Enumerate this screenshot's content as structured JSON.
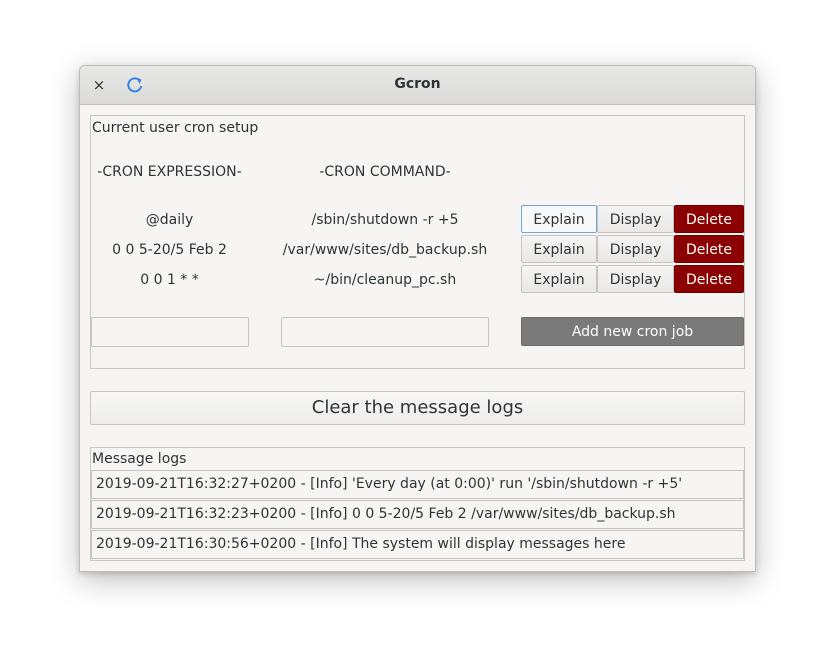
{
  "window": {
    "title": "Gcron"
  },
  "titlebar": {
    "close_glyph": "×",
    "refresh_icon": "refresh-icon"
  },
  "cron_setup": {
    "label": "Current user cron setup",
    "headers": {
      "expression": "-CRON EXPRESSION-",
      "command": "-CRON COMMAND-"
    },
    "jobs": [
      {
        "expression": "@daily",
        "command": "/sbin/shutdown -r +5",
        "explain": "Explain",
        "display": "Display",
        "delete": "Delete"
      },
      {
        "expression": "0 0 5-20/5 Feb 2",
        "command": "/var/www/sites/db_backup.sh",
        "explain": "Explain",
        "display": "Display",
        "delete": "Delete"
      },
      {
        "expression": "0 0 1 * *",
        "command": "~/bin/cleanup_pc.sh",
        "explain": "Explain",
        "display": "Display",
        "delete": "Delete"
      }
    ],
    "new_expression": {
      "value": "",
      "placeholder": ""
    },
    "new_command": {
      "value": "",
      "placeholder": ""
    },
    "add_button": "Add new cron job"
  },
  "clear_button": "Clear the message logs",
  "message_logs": {
    "label": "Message logs",
    "entries": [
      "2019-09-21T16:32:27+0200 - [Info] 'Every day (at 0:00)' run '/sbin/shutdown -r +5'",
      "2019-09-21T16:32:23+0200 - [Info] 0 0 5-20/5 Feb 2 /var/www/sites/db_backup.sh",
      "2019-09-21T16:30:56+0200 - [Info] The system will display messages here"
    ]
  },
  "colors": {
    "delete": "#8b0000",
    "add": "#7a7a7a",
    "focus": "#6fa6d8",
    "refresh": "#3584e4"
  }
}
